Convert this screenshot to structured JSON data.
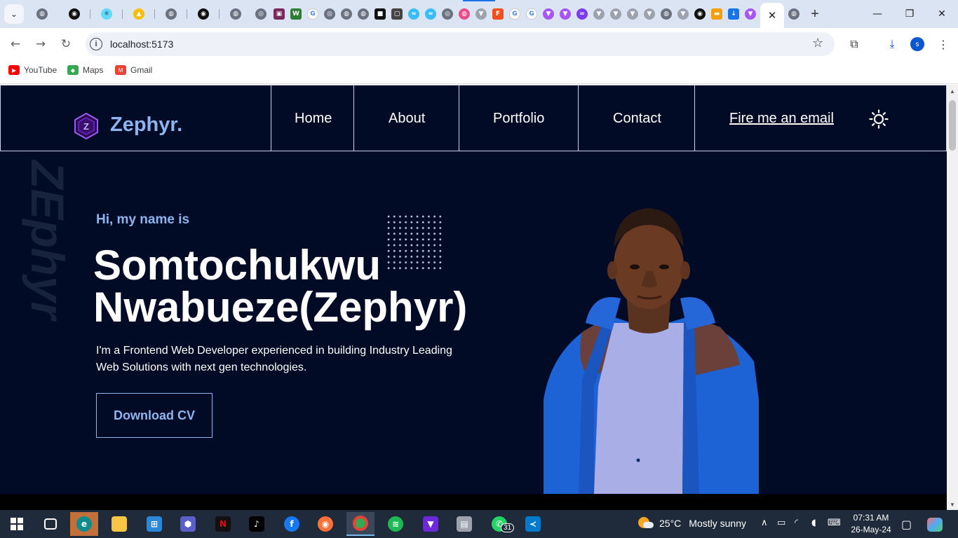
{
  "browser": {
    "url": "localhost:5173",
    "bookmarks": [
      {
        "label": "YouTube",
        "icon": "youtube-icon"
      },
      {
        "label": "Maps",
        "icon": "maps-icon"
      },
      {
        "label": "Gmail",
        "icon": "gmail-icon"
      }
    ],
    "profile_initial": "s"
  },
  "site": {
    "logo": "Zephyr.",
    "nav": {
      "home": "Home",
      "about": "About",
      "portfolio": "Portfolio",
      "contact": "Contact",
      "email": "Fire me an email"
    },
    "watermark": "ZEphyr",
    "hero": {
      "greeting": "Hi, my name is",
      "name_line1": "Somtochukwu",
      "name_line2": "Nwabueze(Zephyr)",
      "bio": "I'm a Frontend Web Developer experienced in building Industry Leading Web Solutions with next gen technologies.",
      "cta": "Download CV"
    },
    "colors": {
      "background": "#020b25",
      "accent": "#8eb4f0",
      "text": "#ffffff"
    }
  },
  "taskbar": {
    "whatsapp_badge": "31",
    "weather": {
      "temp": "25°C",
      "condition": "Mostly sunny"
    },
    "time": "07:31 AM",
    "date": "26-May-24"
  }
}
